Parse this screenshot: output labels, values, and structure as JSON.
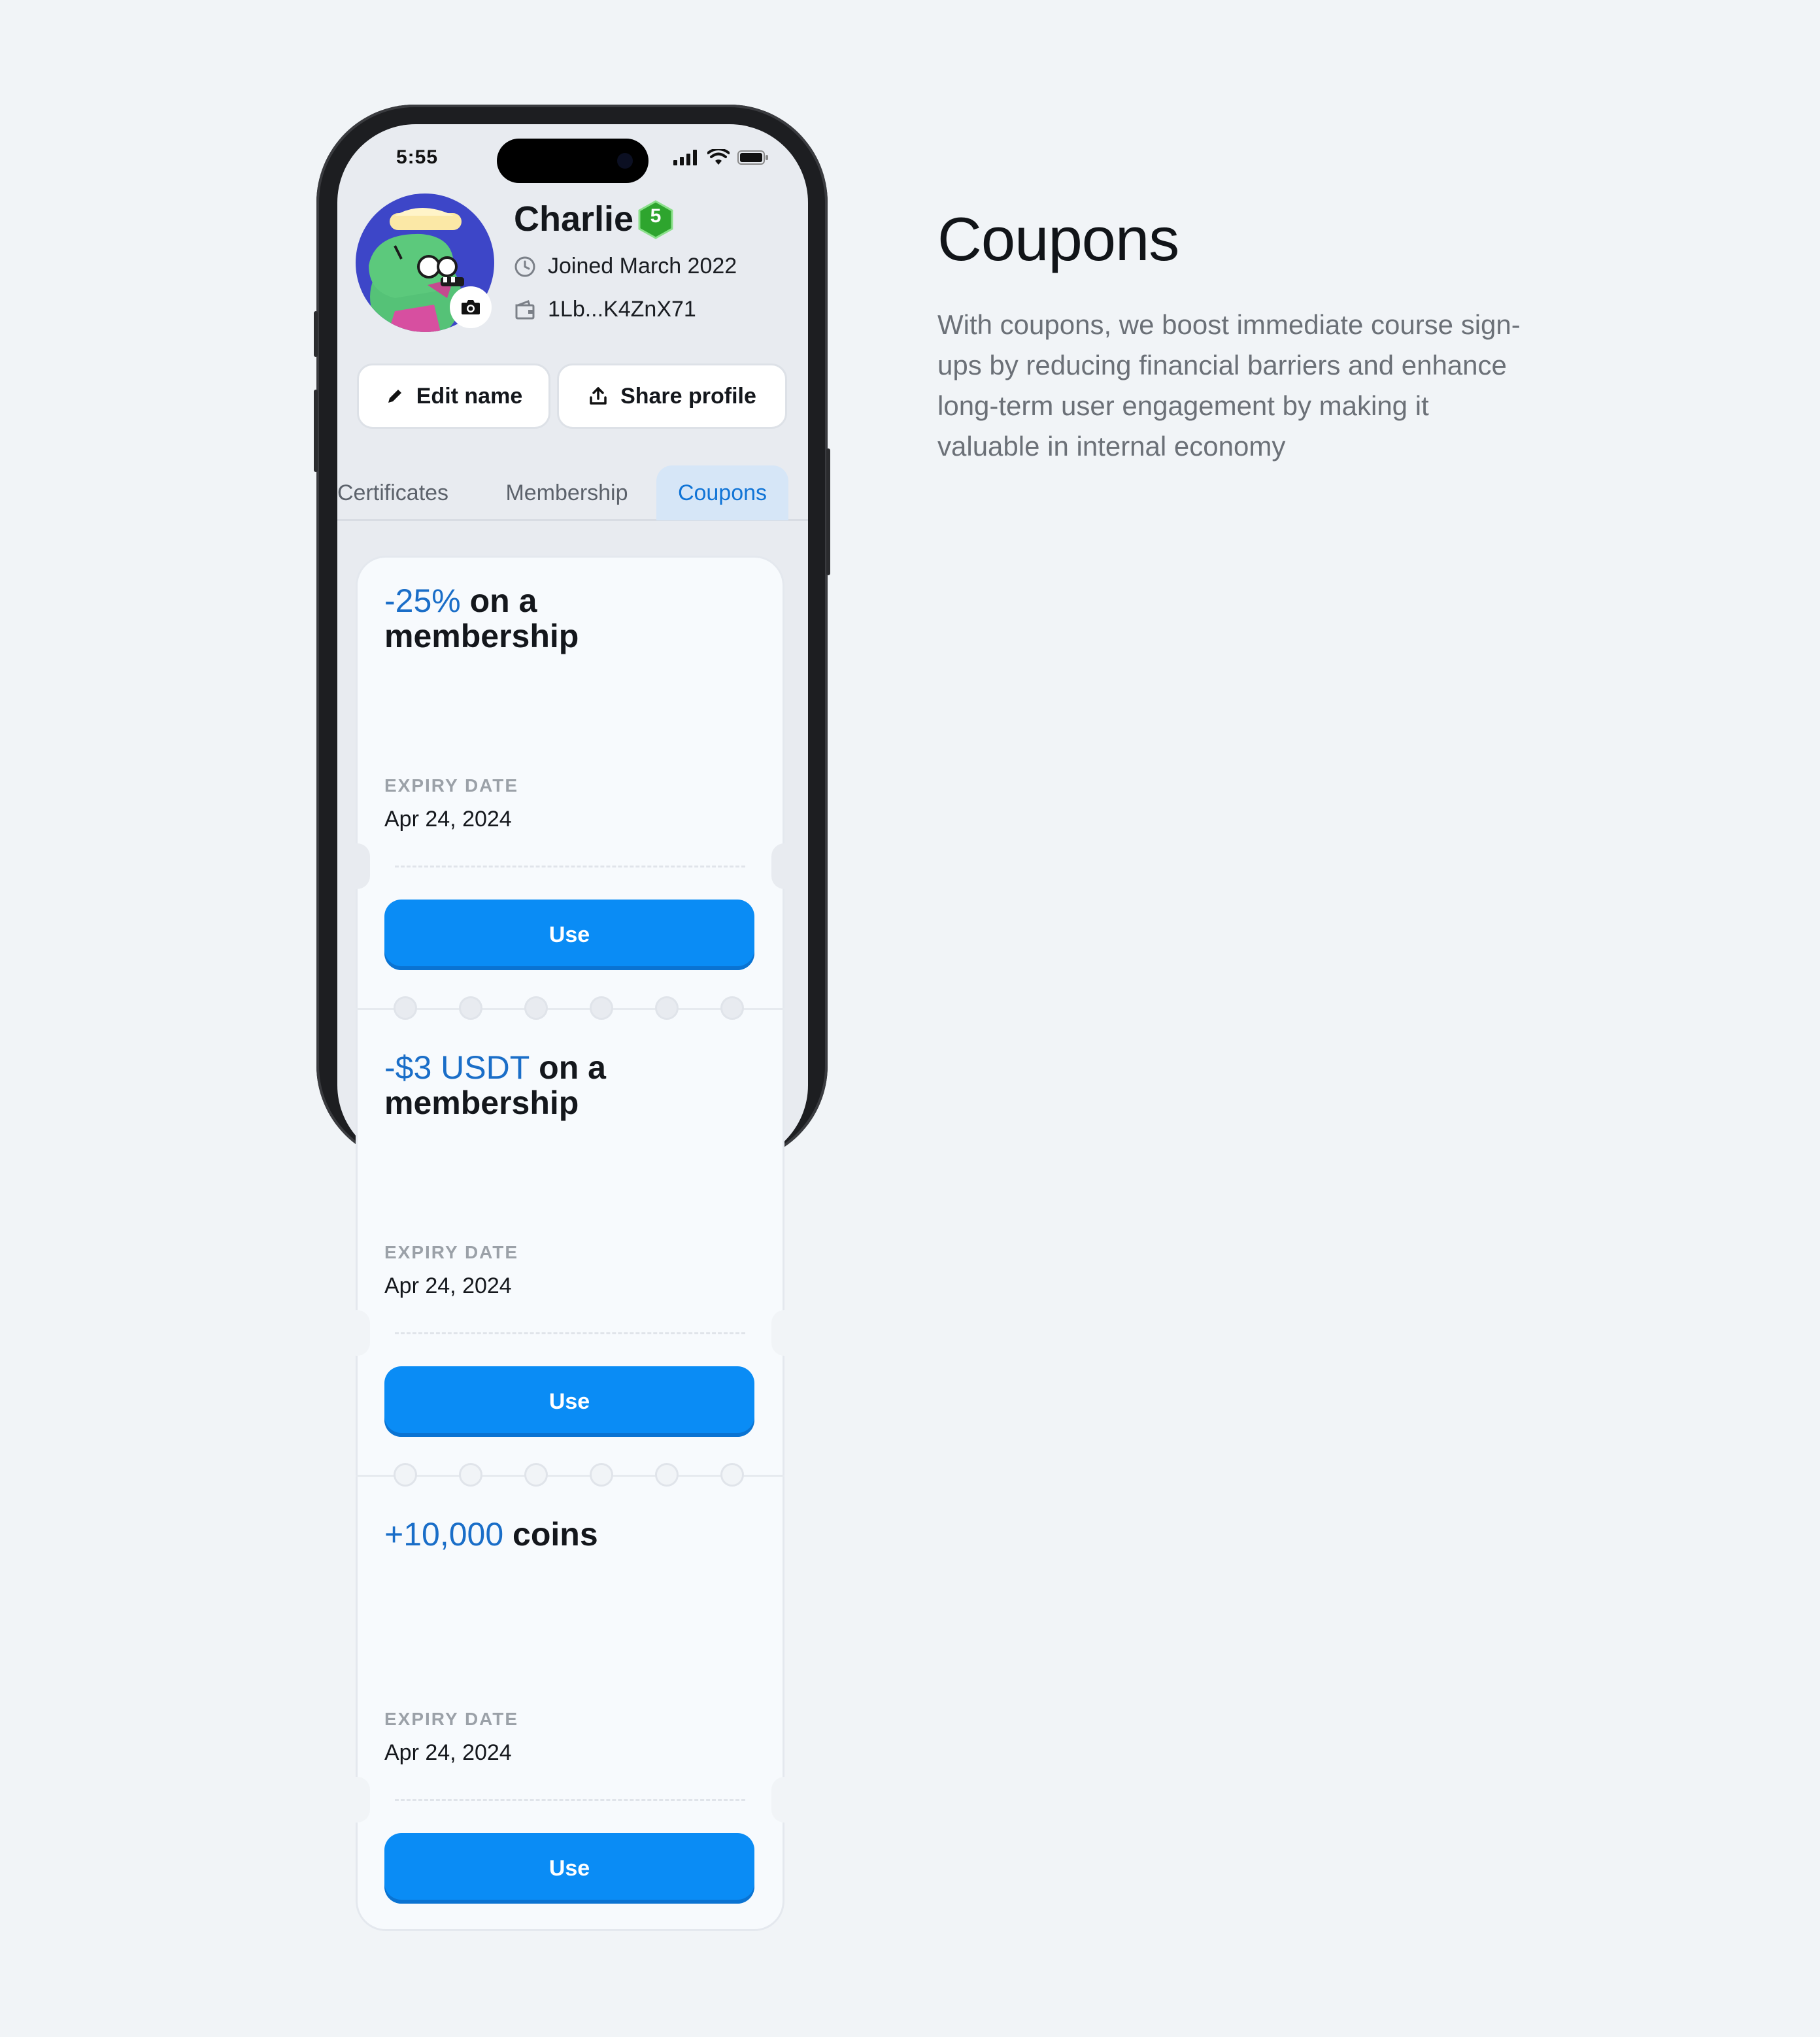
{
  "side": {
    "title": "Coupons",
    "description": "With coupons, we boost immediate course sign-ups by reducing financial barriers and enhance long-term user engagement by making it valuable in internal economy"
  },
  "status_bar": {
    "time": "5:55"
  },
  "profile": {
    "name": "Charlie",
    "level": "5",
    "joined": "Joined March 2022",
    "wallet": "1Lb...K4ZnX71",
    "edit_label": "Edit name",
    "share_label": "Share profile"
  },
  "tabs": [
    {
      "label": "Certificates"
    },
    {
      "label": "Membership"
    },
    {
      "label": "Coupons"
    }
  ],
  "coupons": [
    {
      "highlight": "-25%",
      "rest": " on a",
      "line2": "membership",
      "expiry_label": "EXPIRY DATE",
      "expiry": "Apr 24, 2024",
      "button": "Use"
    },
    {
      "highlight": "-$3 USDT",
      "rest": " on a",
      "line2": "membership",
      "expiry_label": "EXPIRY DATE",
      "expiry": "Apr 24, 2024",
      "button": "Use"
    },
    {
      "highlight": "+10,000",
      "rest": " coins",
      "line2": "",
      "expiry_label": "EXPIRY DATE",
      "expiry": "Apr 24, 2024",
      "button": "Use"
    }
  ],
  "colors": {
    "accent": "#0a8cf5",
    "highlight_text": "#1a6ec8",
    "active_tab_bg": "#d6e6f7",
    "level_badge": "#2ea52e"
  }
}
